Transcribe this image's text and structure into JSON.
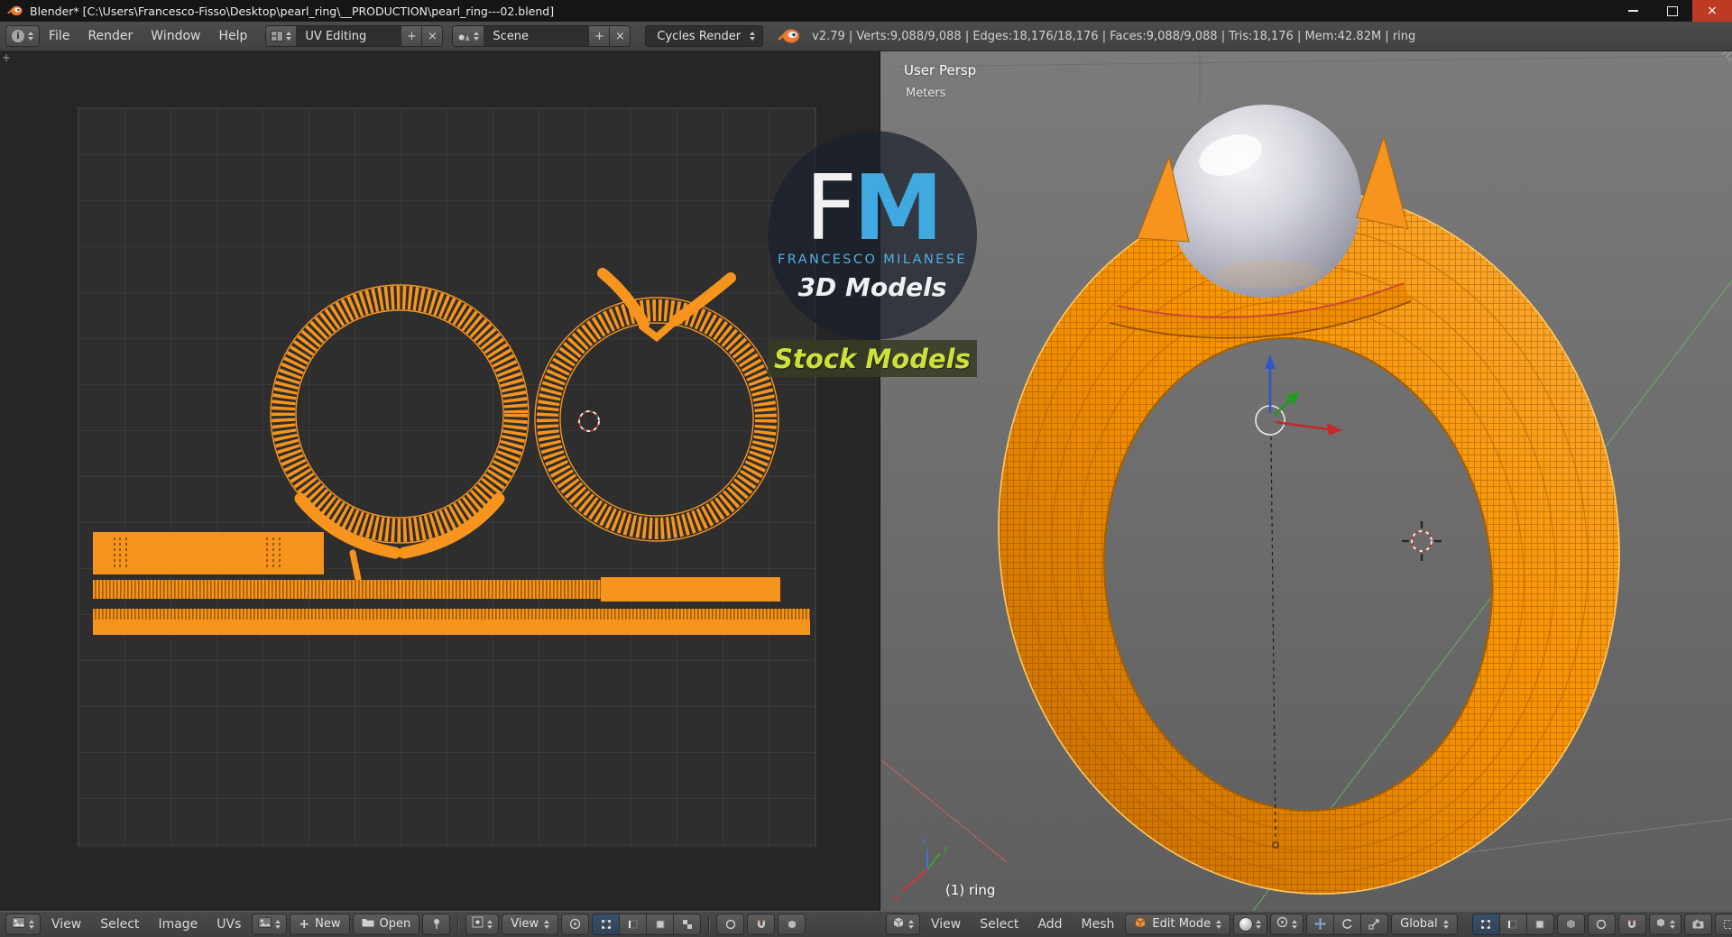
{
  "window": {
    "title": "Blender* [C:\\Users\\Francesco-Fisso\\Desktop\\pearl_ring\\__PRODUCTION\\pearl_ring---02.blend]"
  },
  "info_header": {
    "menus": [
      "File",
      "Render",
      "Window",
      "Help"
    ],
    "layout_name": "UV Editing",
    "scene_name": "Scene",
    "engine": "Cycles Render",
    "stats": "v2.79 | Verts:9,088/9,088 | Edges:18,176/18,176 | Faces:9,088/9,088 | Tris:18,176 | Mem:42.82M | ring"
  },
  "watermark": {
    "logo_f": "F",
    "logo_m": "M",
    "name": "FRANCESCO MILANESE",
    "tagline": "3D Models",
    "banner": "Stock Models"
  },
  "uv_editor": {
    "menus": [
      "View",
      "Select",
      "Image",
      "UVs"
    ],
    "new_label": "New",
    "open_label": "Open",
    "view_dropdown": "View"
  },
  "viewport": {
    "view_label": "User Persp",
    "unit_label": "Meters",
    "object_info": "(1) ring",
    "menus": [
      "View",
      "Select",
      "Add",
      "Mesh"
    ],
    "mode": "Edit Mode",
    "orientation": "Global",
    "axis_x": "x",
    "axis_y": "y",
    "axis_z": "z"
  },
  "colors": {
    "uv_orange": "#f7941d",
    "logo_blue": "#3fa9e0",
    "banner_text": "#cde03c"
  }
}
